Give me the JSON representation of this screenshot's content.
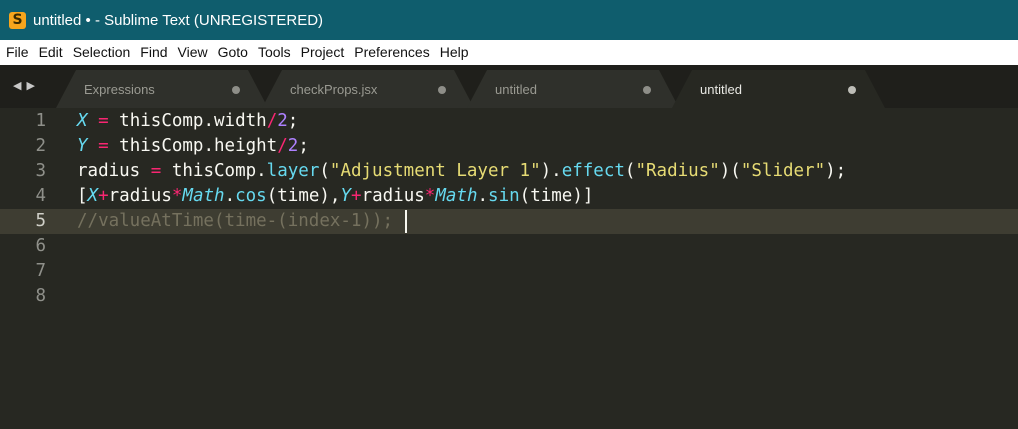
{
  "window": {
    "title": "untitled • - Sublime Text (UNREGISTERED)",
    "icon": "sublime-s-icon",
    "icon_glyph": "S"
  },
  "menu": [
    "File",
    "Edit",
    "Selection",
    "Find",
    "View",
    "Goto",
    "Tools",
    "Project",
    "Preferences",
    "Help"
  ],
  "tabs": [
    {
      "label": "Expressions",
      "active": false
    },
    {
      "label": "checkProps.jsx",
      "active": false
    },
    {
      "label": "untitled",
      "active": false
    },
    {
      "label": "untitled",
      "active": true
    }
  ],
  "nav": {
    "left": "◀",
    "right": "▶"
  },
  "editor": {
    "current_line": 5,
    "line_numbers": [
      "1",
      "2",
      "3",
      "4",
      "5",
      "6",
      "7",
      "8"
    ],
    "lines": [
      [
        {
          "t": "X",
          "c": "var"
        },
        {
          "t": " "
        },
        {
          "t": "=",
          "c": "op"
        },
        {
          "t": " thisComp.width"
        },
        {
          "t": "/",
          "c": "op"
        },
        {
          "t": "2",
          "c": "num"
        },
        {
          "t": ";"
        }
      ],
      [
        {
          "t": "Y",
          "c": "var"
        },
        {
          "t": " "
        },
        {
          "t": "=",
          "c": "op"
        },
        {
          "t": " thisComp.height"
        },
        {
          "t": "/",
          "c": "op"
        },
        {
          "t": "2",
          "c": "num"
        },
        {
          "t": ";"
        }
      ],
      [
        {
          "t": "radius "
        },
        {
          "t": "=",
          "c": "op"
        },
        {
          "t": " thisComp."
        },
        {
          "t": "layer",
          "c": "fn"
        },
        {
          "t": "("
        },
        {
          "t": "\"Adjustment Layer 1\"",
          "c": "str"
        },
        {
          "t": ")."
        },
        {
          "t": "effect",
          "c": "fn"
        },
        {
          "t": "("
        },
        {
          "t": "\"Radius\"",
          "c": "str"
        },
        {
          "t": ")("
        },
        {
          "t": "\"Slider\"",
          "c": "str"
        },
        {
          "t": ");"
        }
      ],
      [
        {
          "t": "["
        },
        {
          "t": "X",
          "c": "var"
        },
        {
          "t": "+",
          "c": "op"
        },
        {
          "t": "radius"
        },
        {
          "t": "*",
          "c": "op"
        },
        {
          "t": "Math",
          "c": "cls"
        },
        {
          "t": "."
        },
        {
          "t": "cos",
          "c": "fn"
        },
        {
          "t": "(time),"
        },
        {
          "t": "Y",
          "c": "var"
        },
        {
          "t": "+",
          "c": "op"
        },
        {
          "t": "radius"
        },
        {
          "t": "*",
          "c": "op"
        },
        {
          "t": "Math",
          "c": "cls"
        },
        {
          "t": "."
        },
        {
          "t": "sin",
          "c": "fn"
        },
        {
          "t": "(time)]"
        }
      ],
      [
        {
          "t": "//valueAtTime(time-(index-1));",
          "c": "comment"
        }
      ],
      [],
      [],
      []
    ]
  }
}
